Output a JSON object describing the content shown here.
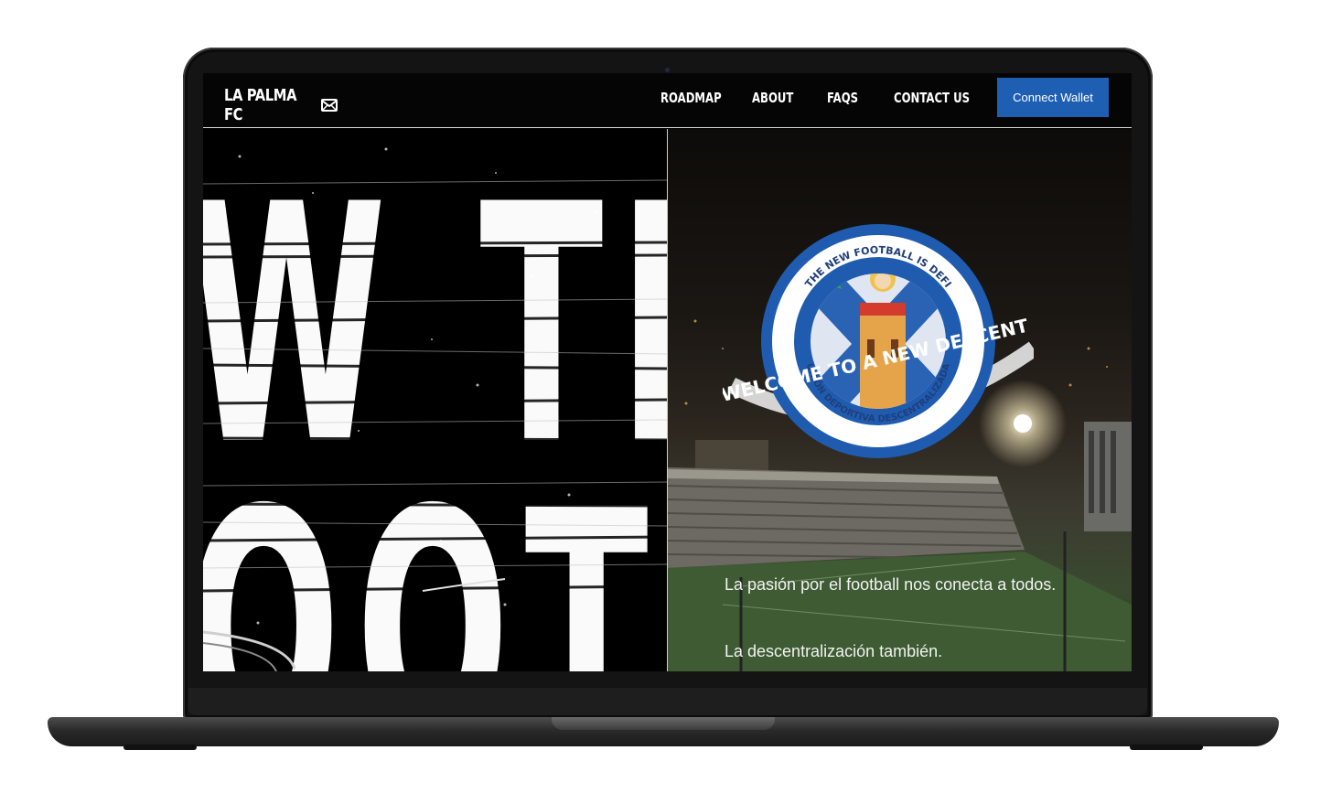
{
  "nav": {
    "brand": "LA PALMA FC",
    "links": [
      {
        "label": "ROADMAP"
      },
      {
        "label": "ABOUT"
      },
      {
        "label": "FAQS"
      },
      {
        "label": "CONTACT US"
      }
    ],
    "cta_label": "Connect Wallet"
  },
  "hero": {
    "big_text_line1": "W TH",
    "big_text_line2": "OOTE",
    "tagline_1": "La pasión por el football nos conecta a todos.",
    "tagline_2": "La descentralización también."
  },
  "badge": {
    "top_text": "THE NEW FOOTBALL IS DEFI",
    "bottom_text": "UNIÓN DEPORTIVA DESCENTRALIZADA",
    "ribbon_text": "WELCOME TO A NEW DESCENTRALIZE EXPERIENCE"
  },
  "colors": {
    "accent": "#1e5fb4",
    "background": "#050505",
    "badge_blue": "#1f5cb0"
  },
  "icons": [
    "envelope-icon"
  ]
}
